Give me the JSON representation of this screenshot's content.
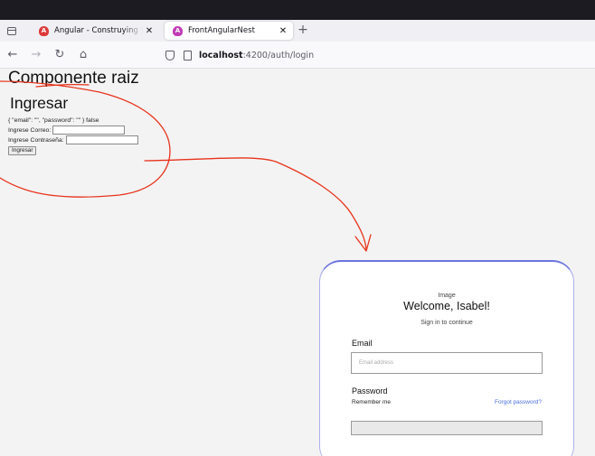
{
  "browser": {
    "tabs": [
      {
        "title": "Angular - Construying y servir a",
        "favicon": "angular-icon",
        "active": false
      },
      {
        "title": "FrontAngularNest",
        "favicon": "angular-icon",
        "active": true
      }
    ],
    "close_glyph": "✕",
    "new_tab_glyph": "+",
    "url_host": "localhost",
    "url_rest": ":4200/auth/login",
    "nav_icons": [
      "back-arrow-icon",
      "forward-arrow-icon",
      "reload-icon",
      "home-icon"
    ]
  },
  "page": {
    "app_title": "Componente raiz",
    "login_title": "Ingresar",
    "debug_text": "{ \"email\": \"\", \"password\": \"\" } false",
    "email_label": "Ingrese Correo:",
    "password_label": "Ingrese Contraseña:",
    "submit_label": "Ingresar"
  },
  "mockup": {
    "image_label": "Image",
    "welcome": "Welcome, Isabel!",
    "subtitle": "Sign in to continue",
    "email_label": "Email",
    "email_placeholder": "Email address",
    "password_label": "Password",
    "remember": "Remember me",
    "forgot": "Forgot password?",
    "accent_color": "#6b73e0"
  },
  "annotation": {
    "stroke_color": "#e8331c"
  }
}
